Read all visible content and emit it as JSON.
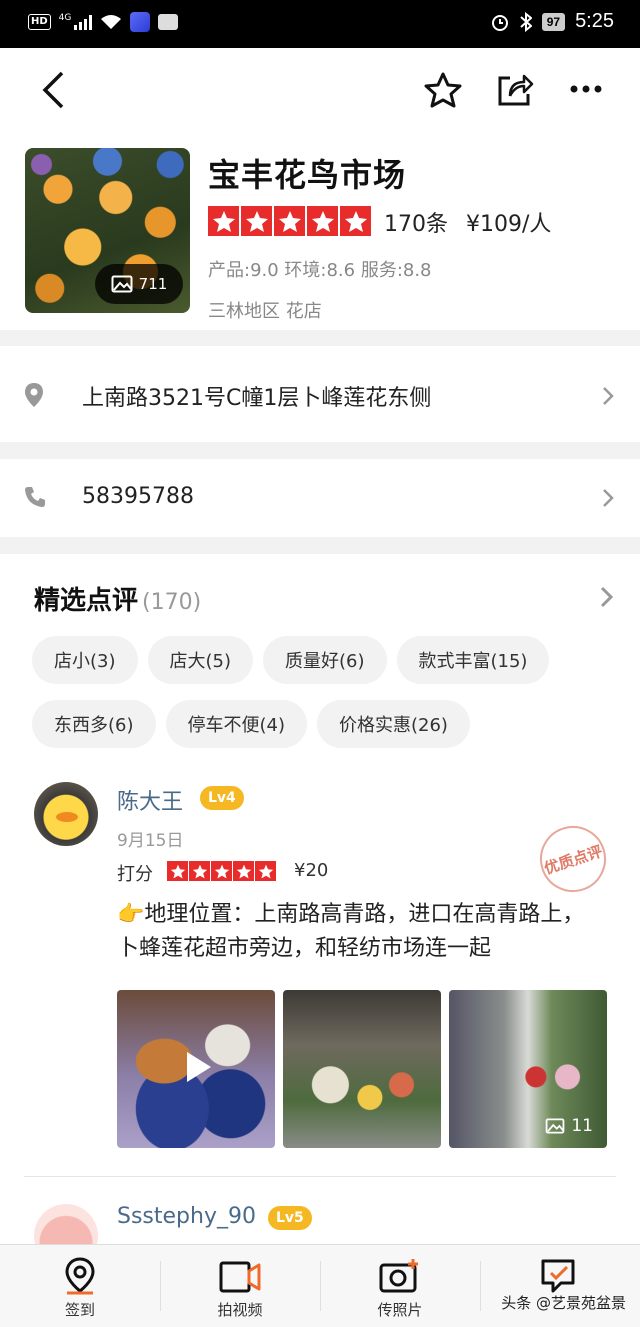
{
  "status_bar": {
    "hd": "HD",
    "network": "4G",
    "battery": "97",
    "time": "5:25"
  },
  "shop": {
    "name": "宝丰花鸟市场",
    "photo_count": "711",
    "review_count": "170条",
    "price_per_person": "¥109/人",
    "rating_stars": 5,
    "scores": "产品:9.0 环境:8.6 服务:8.8",
    "area_category": "三林地区 花店",
    "address": "上南路3521号C幢1层卜峰莲花东侧",
    "phone": "58395788"
  },
  "reviews": {
    "title": "精选点评",
    "count": "(170)",
    "tags": [
      {
        "label": "店小(3)"
      },
      {
        "label": "店大(5)"
      },
      {
        "label": "质量好(6)"
      },
      {
        "label": "款式丰富(15)"
      },
      {
        "label": "东西多(6)"
      },
      {
        "label": "停车不便(4)"
      },
      {
        "label": "价格实惠(26)"
      }
    ],
    "items": [
      {
        "user": "陈大王",
        "level": "Lv4",
        "date": "9月15日",
        "score_label": "打分",
        "stars": 5,
        "price": "¥20",
        "badge": "优质点评",
        "text": "👉地理位置：上南路高青路，进口在高青路上，卜蜂莲花超市旁边，和轻纺市场连一起",
        "more_photos": "11"
      },
      {
        "user": "Ssstephy_90",
        "level": "Lv5"
      }
    ]
  },
  "bottom_bar": {
    "items": [
      {
        "label": "签到",
        "icon": "location-pin-icon"
      },
      {
        "label": "拍视频",
        "icon": "video-camera-icon"
      },
      {
        "label": "传照片",
        "icon": "photo-upload-icon"
      },
      {
        "label": "写点评",
        "icon": "write-review-icon"
      }
    ],
    "watermark": "头条 @艺景苑盆景"
  },
  "colors": {
    "star_red": "#e82b2b",
    "level_badge": "#f5b722",
    "username": "#4a6a8a"
  }
}
